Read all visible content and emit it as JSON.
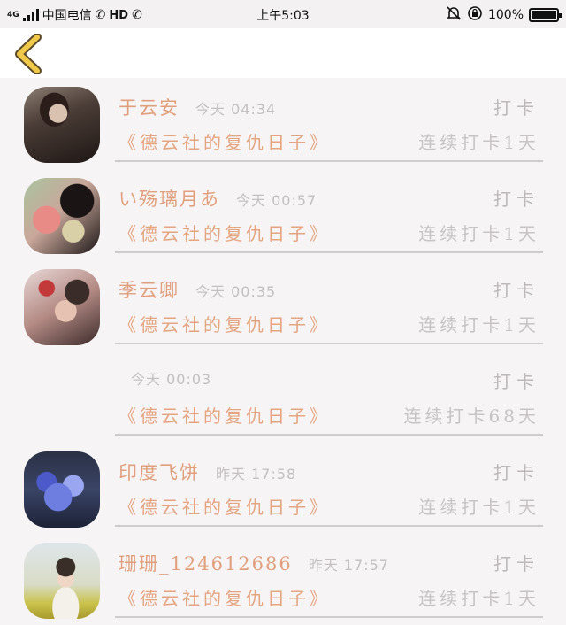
{
  "status_bar": {
    "network": "4G",
    "carrier": "中国电信",
    "hd": "HD",
    "time": "上午5:03",
    "battery": "100%"
  },
  "header": {
    "back_icon": "chevron-left-icon",
    "accent": "#f0c94a"
  },
  "rows": [
    {
      "name": "于云安",
      "time": "今天 04:34",
      "action": "打卡",
      "book": "《德云社的复仇日子》",
      "streak": "连续打卡1天",
      "avatar": "avatar-photo-1"
    },
    {
      "name": "い殇璃月あ",
      "time": "今天 00:57",
      "action": "打卡",
      "book": "《德云社的复仇日子》",
      "streak": "连续打卡1天",
      "avatar": "avatar-photo-2"
    },
    {
      "name": "季云卿",
      "time": "今天 00:35",
      "action": "打卡",
      "book": "《德云社的复仇日子》",
      "streak": "连续打卡1天",
      "avatar": "avatar-photo-3"
    },
    {
      "name": "",
      "time": "今天 00:03",
      "action": "打卡",
      "book": "《德云社的复仇日子》",
      "streak": "连续打卡68天",
      "avatar": ""
    },
    {
      "name": "印度飞饼",
      "time": "昨天 17:58",
      "action": "打卡",
      "book": "《德云社的复仇日子》",
      "streak": "连续打卡1天",
      "avatar": "avatar-photo-5"
    },
    {
      "name": "珊珊_124612686",
      "time": "昨天 17:57",
      "action": "打卡",
      "book": "《德云社的复仇日子》",
      "streak": "连续打卡1天",
      "avatar": "avatar-photo-6"
    }
  ]
}
